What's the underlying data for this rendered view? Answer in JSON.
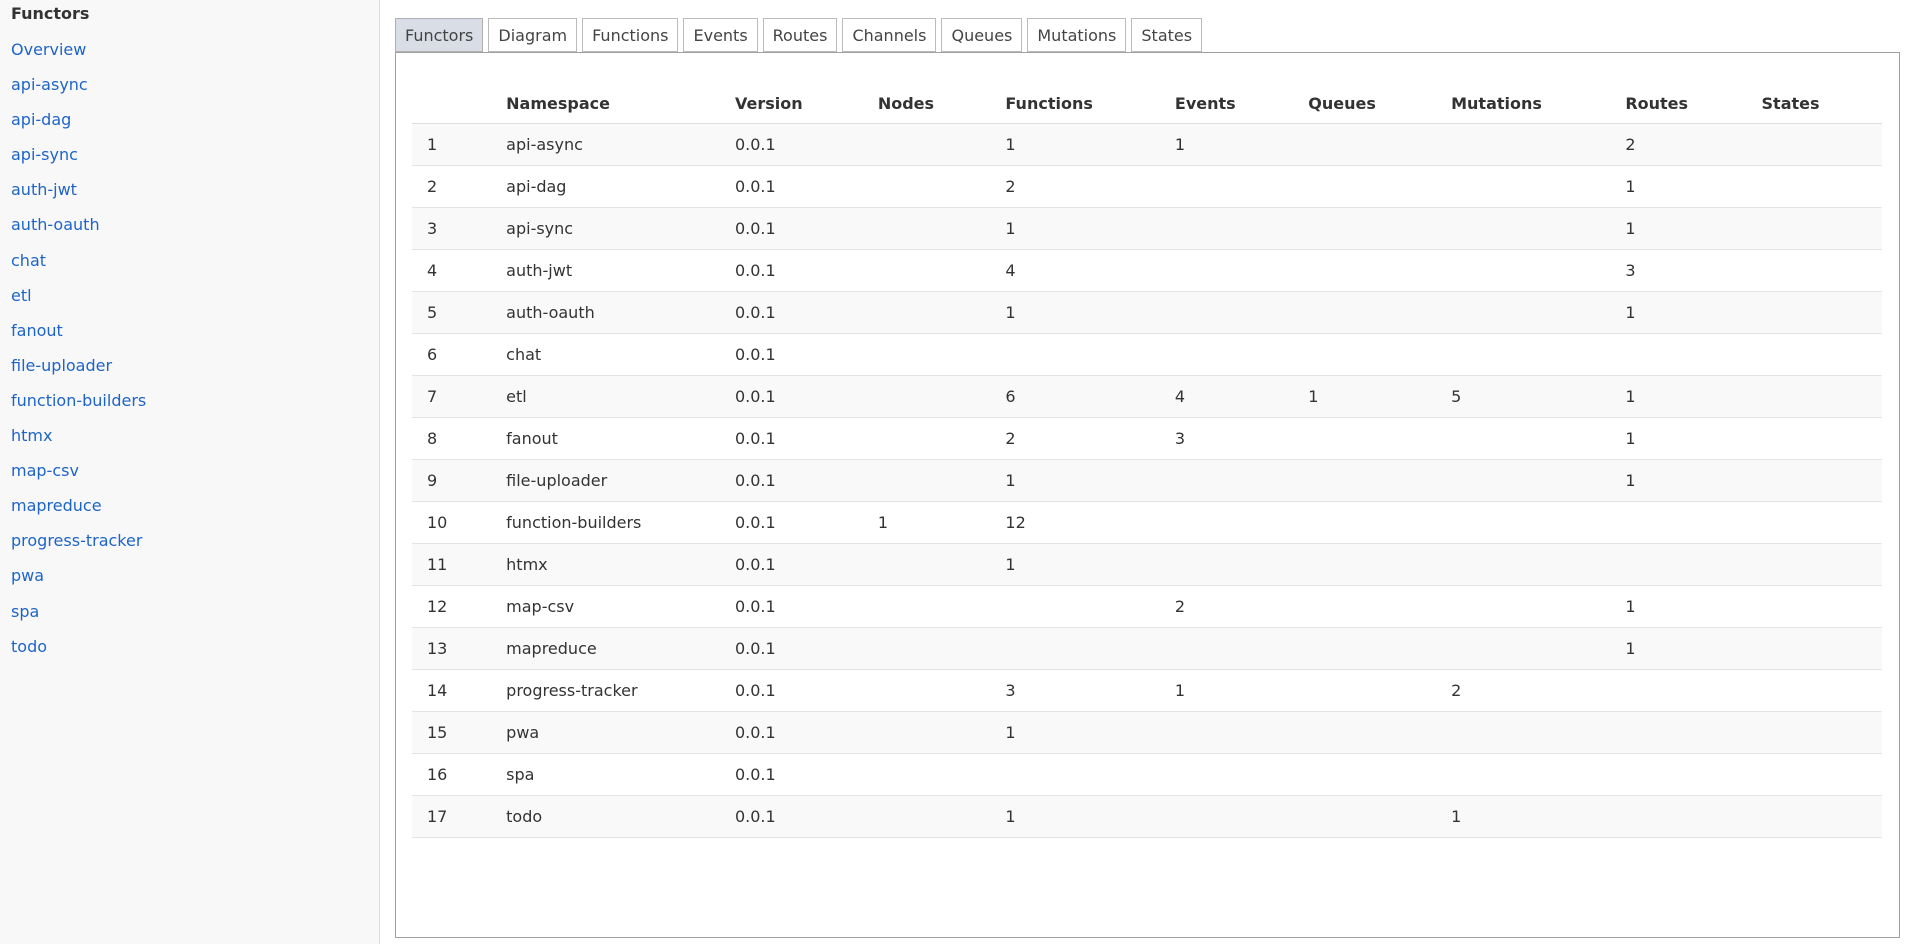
{
  "sidebar": {
    "title": "Functors",
    "items": [
      {
        "label": "Overview"
      },
      {
        "label": "api-async"
      },
      {
        "label": "api-dag"
      },
      {
        "label": "api-sync"
      },
      {
        "label": "auth-jwt"
      },
      {
        "label": "auth-oauth"
      },
      {
        "label": "chat"
      },
      {
        "label": "etl"
      },
      {
        "label": "fanout"
      },
      {
        "label": "file-uploader"
      },
      {
        "label": "function-builders"
      },
      {
        "label": "htmx"
      },
      {
        "label": "map-csv"
      },
      {
        "label": "mapreduce"
      },
      {
        "label": "progress-tracker"
      },
      {
        "label": "pwa"
      },
      {
        "label": "spa"
      },
      {
        "label": "todo"
      }
    ]
  },
  "tabs": [
    {
      "label": "Functors",
      "active": true
    },
    {
      "label": "Diagram"
    },
    {
      "label": "Functions"
    },
    {
      "label": "Events"
    },
    {
      "label": "Routes"
    },
    {
      "label": "Channels"
    },
    {
      "label": "Queues"
    },
    {
      "label": "Mutations"
    },
    {
      "label": "States"
    }
  ],
  "table": {
    "columns": [
      "",
      "Namespace",
      "Version",
      "Nodes",
      "Functions",
      "Events",
      "Queues",
      "Mutations",
      "Routes",
      "States"
    ],
    "rows": [
      [
        "1",
        "api-async",
        "0.0.1",
        "",
        "1",
        "1",
        "",
        "",
        "2",
        ""
      ],
      [
        "2",
        "api-dag",
        "0.0.1",
        "",
        "2",
        "",
        "",
        "",
        "1",
        ""
      ],
      [
        "3",
        "api-sync",
        "0.0.1",
        "",
        "1",
        "",
        "",
        "",
        "1",
        ""
      ],
      [
        "4",
        "auth-jwt",
        "0.0.1",
        "",
        "4",
        "",
        "",
        "",
        "3",
        ""
      ],
      [
        "5",
        "auth-oauth",
        "0.0.1",
        "",
        "1",
        "",
        "",
        "",
        "1",
        ""
      ],
      [
        "6",
        "chat",
        "0.0.1",
        "",
        "",
        "",
        "",
        "",
        "",
        ""
      ],
      [
        "7",
        "etl",
        "0.0.1",
        "",
        "6",
        "4",
        "1",
        "5",
        "1",
        ""
      ],
      [
        "8",
        "fanout",
        "0.0.1",
        "",
        "2",
        "3",
        "",
        "",
        "1",
        ""
      ],
      [
        "9",
        "file-uploader",
        "0.0.1",
        "",
        "1",
        "",
        "",
        "",
        "1",
        ""
      ],
      [
        "10",
        "function-builders",
        "0.0.1",
        "1",
        "12",
        "",
        "",
        "",
        "",
        ""
      ],
      [
        "11",
        "htmx",
        "0.0.1",
        "",
        "1",
        "",
        "",
        "",
        "",
        ""
      ],
      [
        "12",
        "map-csv",
        "0.0.1",
        "",
        "",
        "2",
        "",
        "",
        "1",
        ""
      ],
      [
        "13",
        "mapreduce",
        "0.0.1",
        "",
        "",
        "",
        "",
        "",
        "1",
        ""
      ],
      [
        "14",
        "progress-tracker",
        "0.0.1",
        "",
        "3",
        "1",
        "",
        "2",
        "",
        ""
      ],
      [
        "15",
        "pwa",
        "0.0.1",
        "",
        "1",
        "",
        "",
        "",
        "",
        ""
      ],
      [
        "16",
        "spa",
        "0.0.1",
        "",
        "",
        "",
        "",
        "",
        "",
        ""
      ],
      [
        "17",
        "todo",
        "0.0.1",
        "",
        "1",
        "",
        "",
        "1",
        "",
        ""
      ]
    ]
  }
}
